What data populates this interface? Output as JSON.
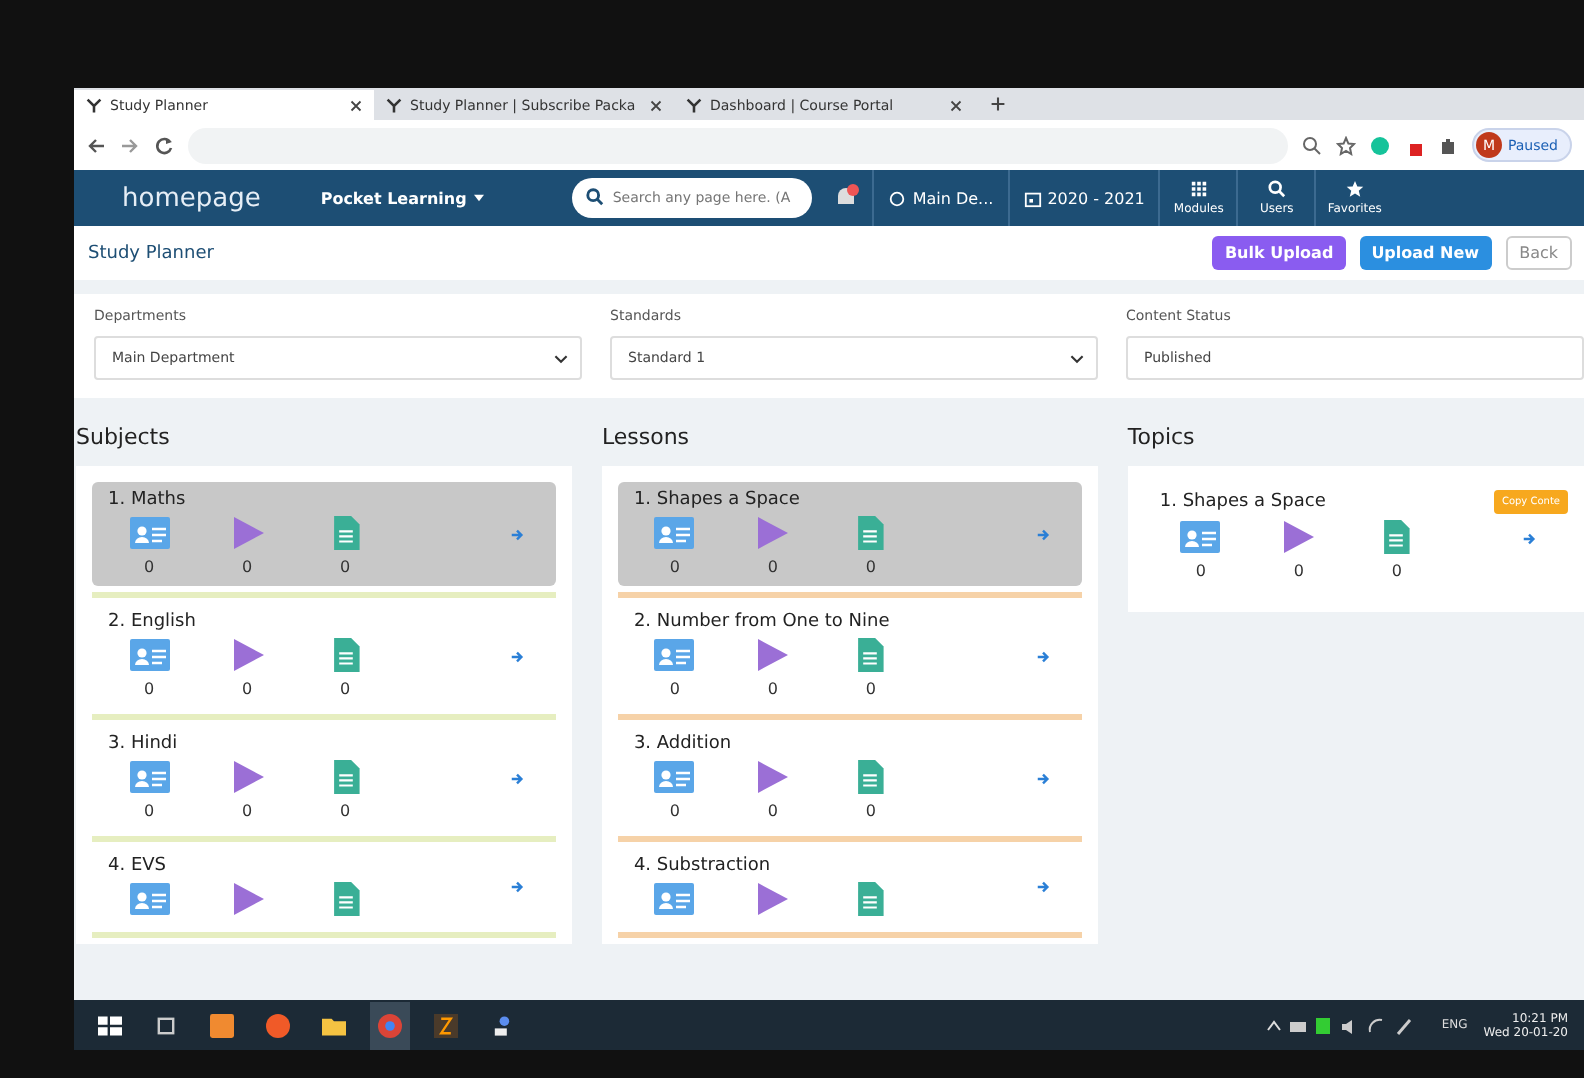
{
  "browser": {
    "tabs": [
      {
        "title": "Study Planner",
        "selected": true
      },
      {
        "title": "Study Planner | Subscribe Packa",
        "selected": false
      },
      {
        "title": "Dashboard | Course Portal",
        "selected": false
      }
    ],
    "profile": {
      "initial": "M",
      "status": "Paused"
    }
  },
  "navbar": {
    "logo": "homepage",
    "menu": "Pocket Learning",
    "search": {
      "placeholder": "Search any page here. (A"
    },
    "department": "Main De...",
    "year": "2020 - 2021",
    "icons": [
      "Modules",
      "Users",
      "Favorites"
    ]
  },
  "page": {
    "title": "Study Planner",
    "buttons": [
      {
        "label": "Bulk Upload",
        "kind": "bulk"
      },
      {
        "label": "Upload New",
        "kind": "new"
      },
      {
        "label": "Back",
        "kind": "back"
      }
    ]
  },
  "filters": [
    {
      "label": "Departments",
      "value": "Main Department",
      "kind": "select"
    },
    {
      "label": "Standards",
      "value": "Standard 1",
      "kind": "select"
    },
    {
      "label": "Content Status",
      "value": "Published",
      "kind": "text"
    }
  ],
  "columns": [
    {
      "title": "Subjects",
      "color": "#e6eec0",
      "items": [
        {
          "name": "1. Maths",
          "selected": true,
          "counts": [
            "0",
            "0",
            "0"
          ]
        },
        {
          "name": "2. English",
          "selected": false,
          "counts": [
            "0",
            "0",
            "0"
          ]
        },
        {
          "name": "3. Hindi",
          "selected": false,
          "counts": [
            "0",
            "0",
            "0"
          ]
        },
        {
          "name": "4. EVS",
          "selected": false
        }
      ]
    },
    {
      "title": "Lessons",
      "color": "#f6d2a8",
      "items": [
        {
          "name": "1. Shapes a Space",
          "selected": true,
          "counts": [
            "0",
            "0",
            "0"
          ]
        },
        {
          "name": "2. Number from One to Nine",
          "selected": false,
          "counts": [
            "0",
            "0",
            "0"
          ]
        },
        {
          "name": "3. Addition",
          "selected": false,
          "counts": [
            "0",
            "0",
            "0"
          ]
        },
        {
          "name": "4. Substraction",
          "selected": false
        }
      ]
    },
    {
      "title": "Topics",
      "items": [
        {
          "name": "1. Shapes a Space",
          "selected": false,
          "counts": [
            "0",
            "0",
            "0"
          ],
          "action": "Copy Conte"
        }
      ]
    }
  ],
  "taskbar": {
    "language": "ENG",
    "time": "10:21 PM",
    "date": "Wed 20-01-20"
  }
}
